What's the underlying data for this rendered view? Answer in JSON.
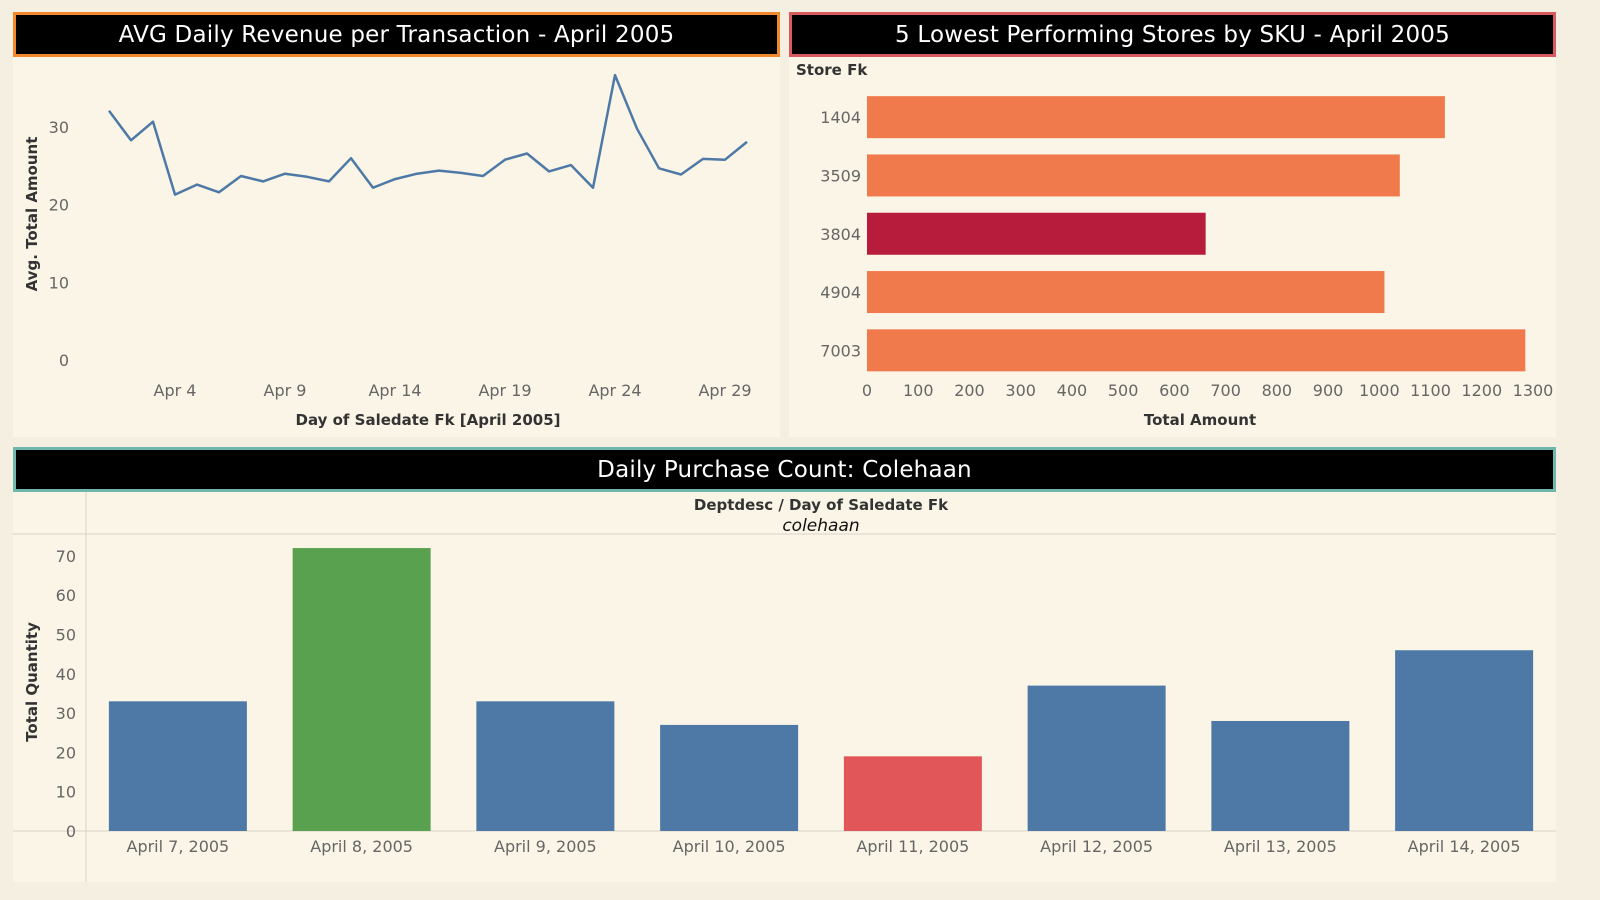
{
  "dashboard": {
    "line_title": "AVG Daily Revenue per Transaction - April 2005",
    "bar_title": "5 Lowest Performing Stores by SKU - April 2005",
    "purchase_title": "Daily Purchase Count: Colehaan"
  },
  "chart_data": [
    {
      "type": "line",
      "title": "AVG Daily Revenue per Transaction - April 2005",
      "xlabel": "Day of Saledate Fk [April 2005]",
      "ylabel": "Avg. Total Amount",
      "x_tick_labels": [
        "Apr 4",
        "Apr 9",
        "Apr 14",
        "Apr 19",
        "Apr 24",
        "Apr 29"
      ],
      "x_tick_days": [
        4,
        9,
        14,
        19,
        24,
        29
      ],
      "y_ticks": [
        0,
        10,
        20,
        30
      ],
      "ylim": [
        0,
        38
      ],
      "xlim": [
        0.5,
        30.5
      ],
      "color": "#4e79a7",
      "series": [
        {
          "x": [
            1,
            2,
            3,
            4,
            5,
            6,
            7,
            8,
            9,
            10,
            11,
            12,
            13,
            14,
            15,
            16,
            17,
            18,
            19,
            20,
            21,
            22,
            23,
            24,
            25,
            26,
            27,
            28,
            29,
            30
          ],
          "values": [
            32.1,
            28.3,
            30.7,
            21.3,
            22.6,
            21.6,
            23.7,
            23.0,
            24.0,
            23.6,
            23.0,
            26.0,
            22.2,
            23.3,
            24.0,
            24.4,
            24.1,
            23.7,
            25.8,
            26.6,
            24.3,
            25.1,
            22.2,
            36.7,
            29.8,
            24.7,
            23.9,
            25.9,
            25.8,
            28.1
          ]
        }
      ],
      "grid": false
    },
    {
      "type": "bar",
      "orientation": "horizontal",
      "title": "5 Lowest Performing Stores by SKU - April 2005",
      "row_header": "Store Fk",
      "xlabel": "Total Amount",
      "categories": [
        "1404",
        "3509",
        "3804",
        "4904",
        "7003"
      ],
      "values": [
        1128,
        1040,
        661,
        1010,
        1285
      ],
      "colors": [
        "#f07a4b",
        "#f07a4b",
        "#b71c3d",
        "#f07a4b",
        "#f07a4b"
      ],
      "x_ticks": [
        0,
        100,
        200,
        300,
        400,
        500,
        600,
        700,
        800,
        900,
        1000,
        1100,
        1200,
        1300
      ],
      "xlim": [
        0,
        1300
      ]
    },
    {
      "type": "bar",
      "title": "Daily Purchase Count: Colehaan",
      "header": "Deptdesc  /  Day of Saledate Fk",
      "subheader": "colehaan",
      "ylabel": "Total Quantity",
      "categories": [
        "April 7, 2005",
        "April 8, 2005",
        "April 9, 2005",
        "April 10, 2005",
        "April 11, 2005",
        "April 12, 2005",
        "April 13, 2005",
        "April 14, 2005"
      ],
      "values": [
        33,
        72,
        33,
        27,
        19,
        37,
        28,
        46
      ],
      "colors": [
        "#4e79a7",
        "#59a14f",
        "#4e79a7",
        "#4e79a7",
        "#e15759",
        "#4e79a7",
        "#4e79a7",
        "#4e79a7"
      ],
      "y_ticks": [
        0,
        10,
        20,
        30,
        40,
        50,
        60,
        70
      ],
      "ylim": [
        0,
        75
      ]
    }
  ]
}
